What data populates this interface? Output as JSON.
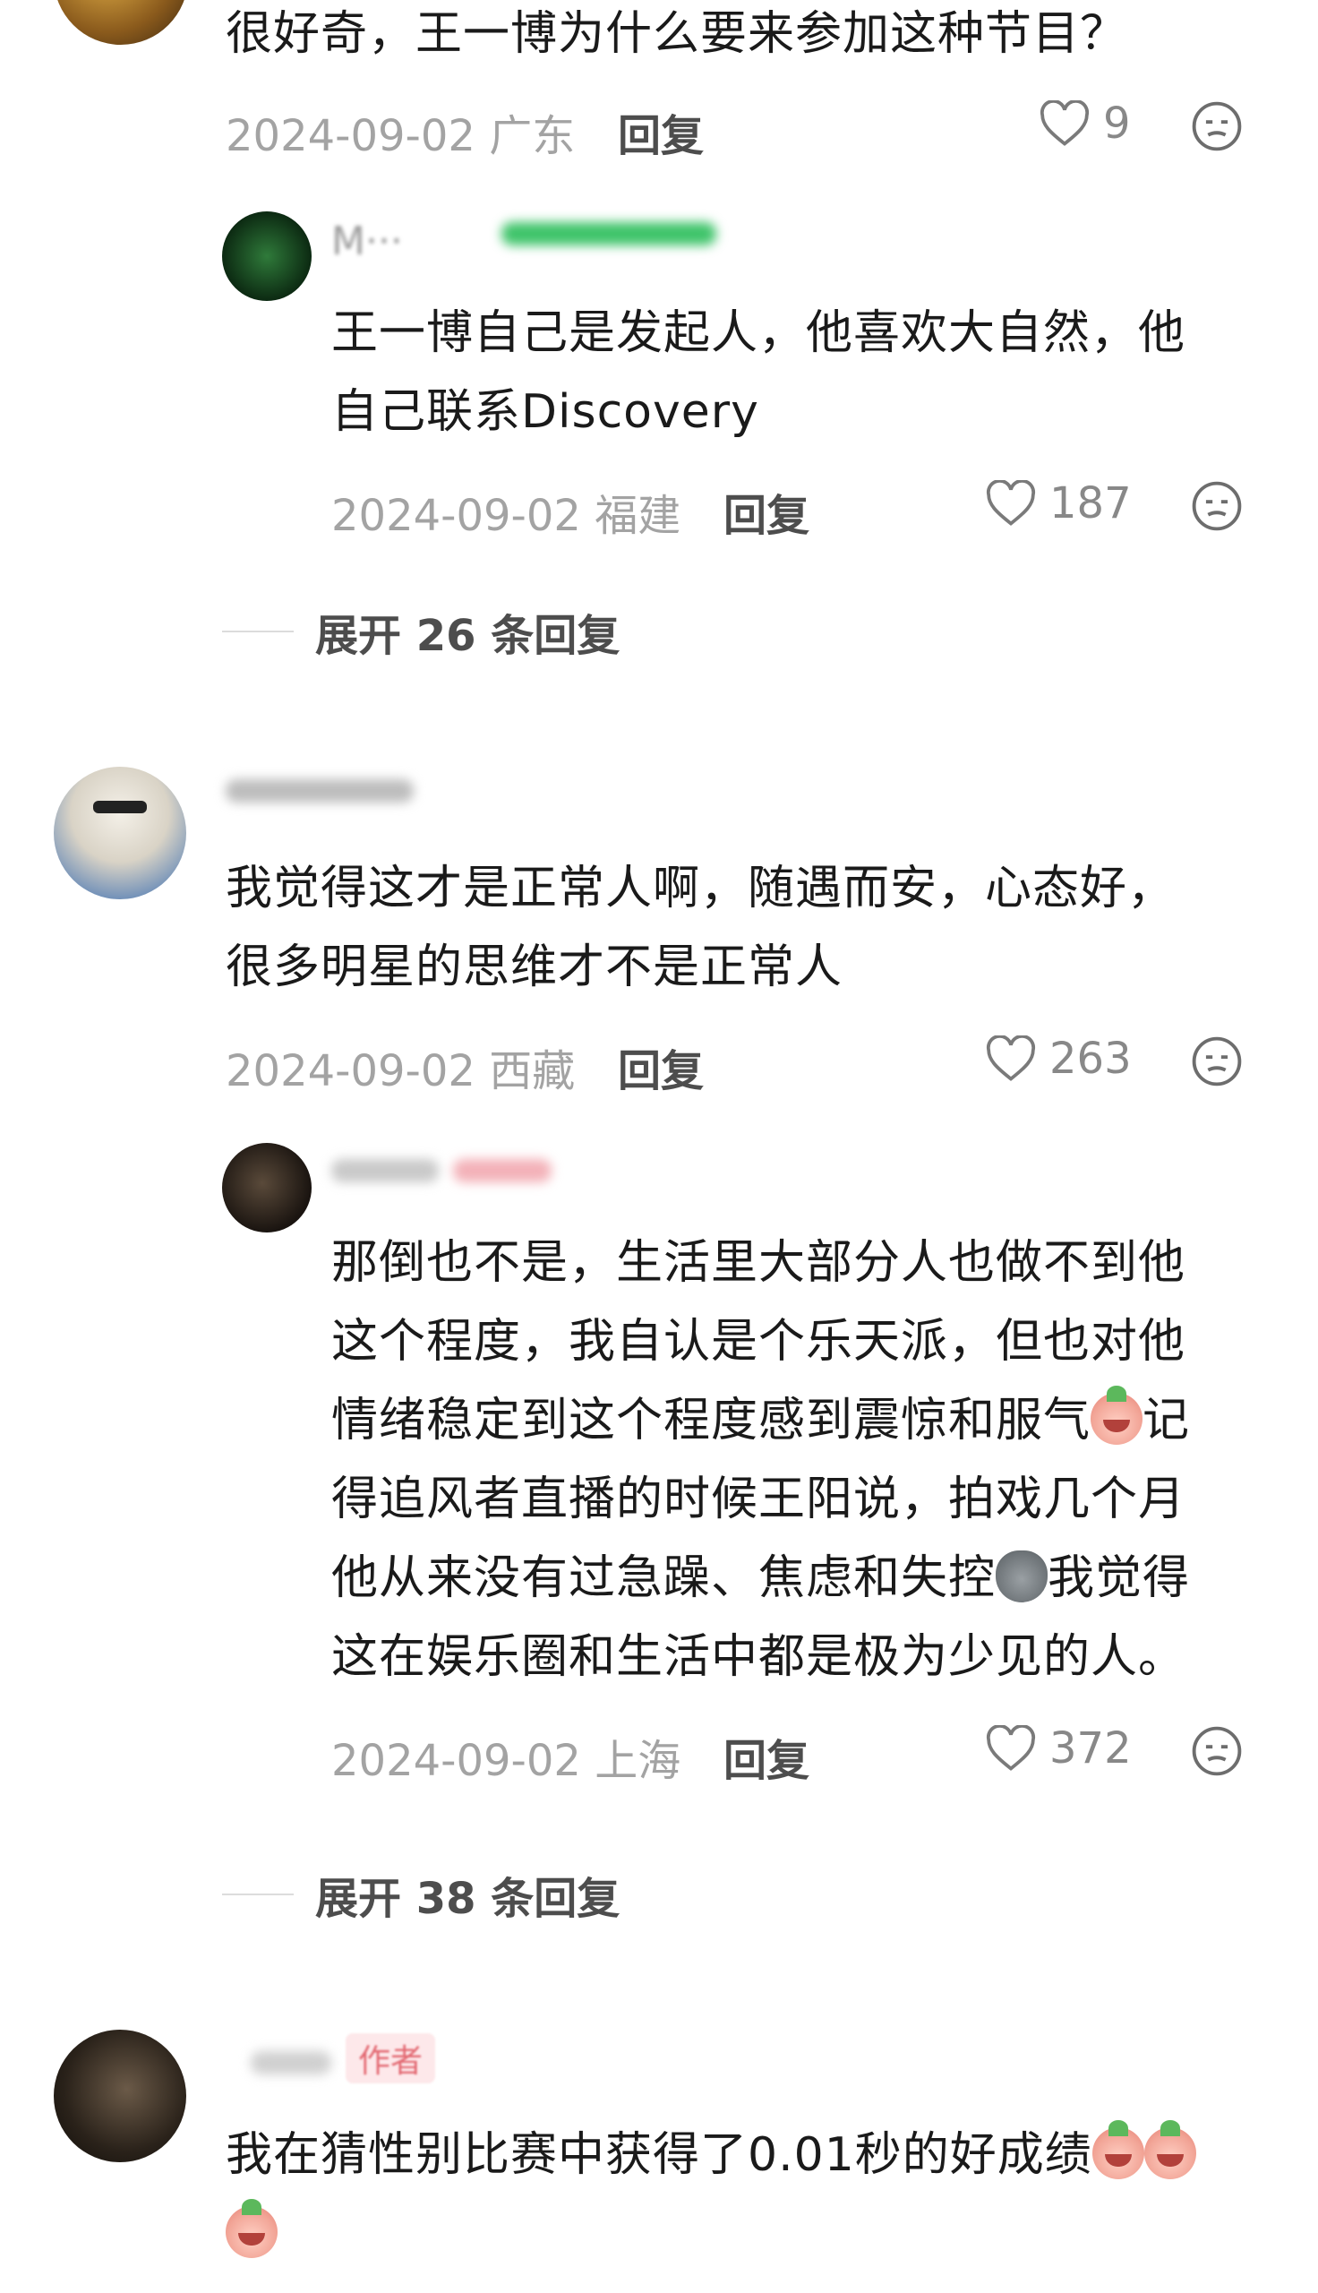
{
  "comments": [
    {
      "text": "很好奇，王一博为什么要来参加这种节目？",
      "date": "2024-09-02",
      "location": "广东",
      "reply_label": "回复",
      "likes": "9",
      "reply": {
        "username": "M···",
        "text_line1": "王一博自己是发起人，他喜欢大自然，他",
        "text_line2": "自己联系Discovery",
        "date": "2024-09-02",
        "location": "福建",
        "reply_label": "回复",
        "likes": "187"
      },
      "expand_label": "展开 26 条回复"
    },
    {
      "text_line1": "我觉得这才是正常人啊，随遇而安，心态好，",
      "text_line2": "很多明星的思维才不是正常人",
      "date": "2024-09-02",
      "location": "西藏",
      "reply_label": "回复",
      "likes": "263",
      "reply": {
        "line1": "那倒也不是，生活里大部分人也做不到他",
        "line2": "这个程度，我自认是个乐天派，但也对他",
        "line3a": "情绪稳定到这个程度感到震惊和服气",
        "line3b": "记",
        "line4": "得追风者直播的时候王阳说，拍戏几个月",
        "line5a": "他从来没有过急躁、焦虑和失控",
        "line5b": "我觉得",
        "line6": "这在娱乐圈和生活中都是极为少见的人。",
        "date": "2024-09-02",
        "location": "上海",
        "reply_label": "回复",
        "likes": "372"
      },
      "expand_label": "展开 38 条回复"
    },
    {
      "author_tag": "作者",
      "text_line1": "我在猜性别比赛中获得了0.01秒的好成绩"
    }
  ],
  "icons": {
    "like": "heart-outline-icon",
    "dislike": "meh-face-icon",
    "emoji_cry": "crying-face-emoji",
    "emoji_bag": "sandbag-emoji"
  },
  "colors": {
    "text": "#1a1a1a",
    "meta": "#a3a3a3",
    "action": "#4d4d4d",
    "author_tag": "#e36a73"
  }
}
